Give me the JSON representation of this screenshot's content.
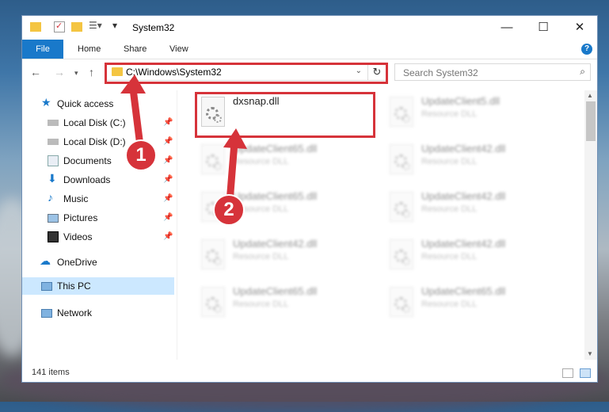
{
  "window": {
    "title": "System32"
  },
  "ribbon": {
    "file": "File",
    "tabs": [
      "Home",
      "Share",
      "View"
    ],
    "help": "?"
  },
  "nav": {
    "address": "C:\\Windows\\System32",
    "search_placeholder": "Search System32"
  },
  "sidebar": {
    "items": [
      {
        "label": "Quick access"
      },
      {
        "label": "Local Disk (C:)"
      },
      {
        "label": "Local Disk (D:)"
      },
      {
        "label": "Documents"
      },
      {
        "label": "Downloads"
      },
      {
        "label": "Music"
      },
      {
        "label": "Pictures"
      },
      {
        "label": "Videos"
      },
      {
        "label": "OneDrive"
      },
      {
        "label": "This PC"
      },
      {
        "label": "Network"
      }
    ]
  },
  "files": [
    {
      "name": "dxsnap.dll",
      "type": ""
    },
    {
      "name": "UpdateClient5.dll",
      "type": "Resource DLL"
    },
    {
      "name": "UpdateClient65.dll",
      "type": "Resource DLL"
    },
    {
      "name": "UpdateClient42.dll",
      "type": "Resource DLL"
    },
    {
      "name": "UpdateClient65.dll",
      "type": "Resource DLL"
    },
    {
      "name": "UpdateClient42.dll",
      "type": "Resource DLL"
    },
    {
      "name": "UpdateClient42.dll",
      "type": "Resource DLL"
    },
    {
      "name": "UpdateClient42.dll",
      "type": "Resource DLL"
    },
    {
      "name": "UpdateClient65.dll",
      "type": "Resource DLL"
    },
    {
      "name": "UpdateClient65.dll",
      "type": "Resource DLL"
    }
  ],
  "status": {
    "count": "141 items"
  },
  "callouts": [
    "1",
    "2"
  ],
  "colors": {
    "accent": "#1979ca",
    "highlight": "#d6333a",
    "selected": "#cce8ff"
  }
}
